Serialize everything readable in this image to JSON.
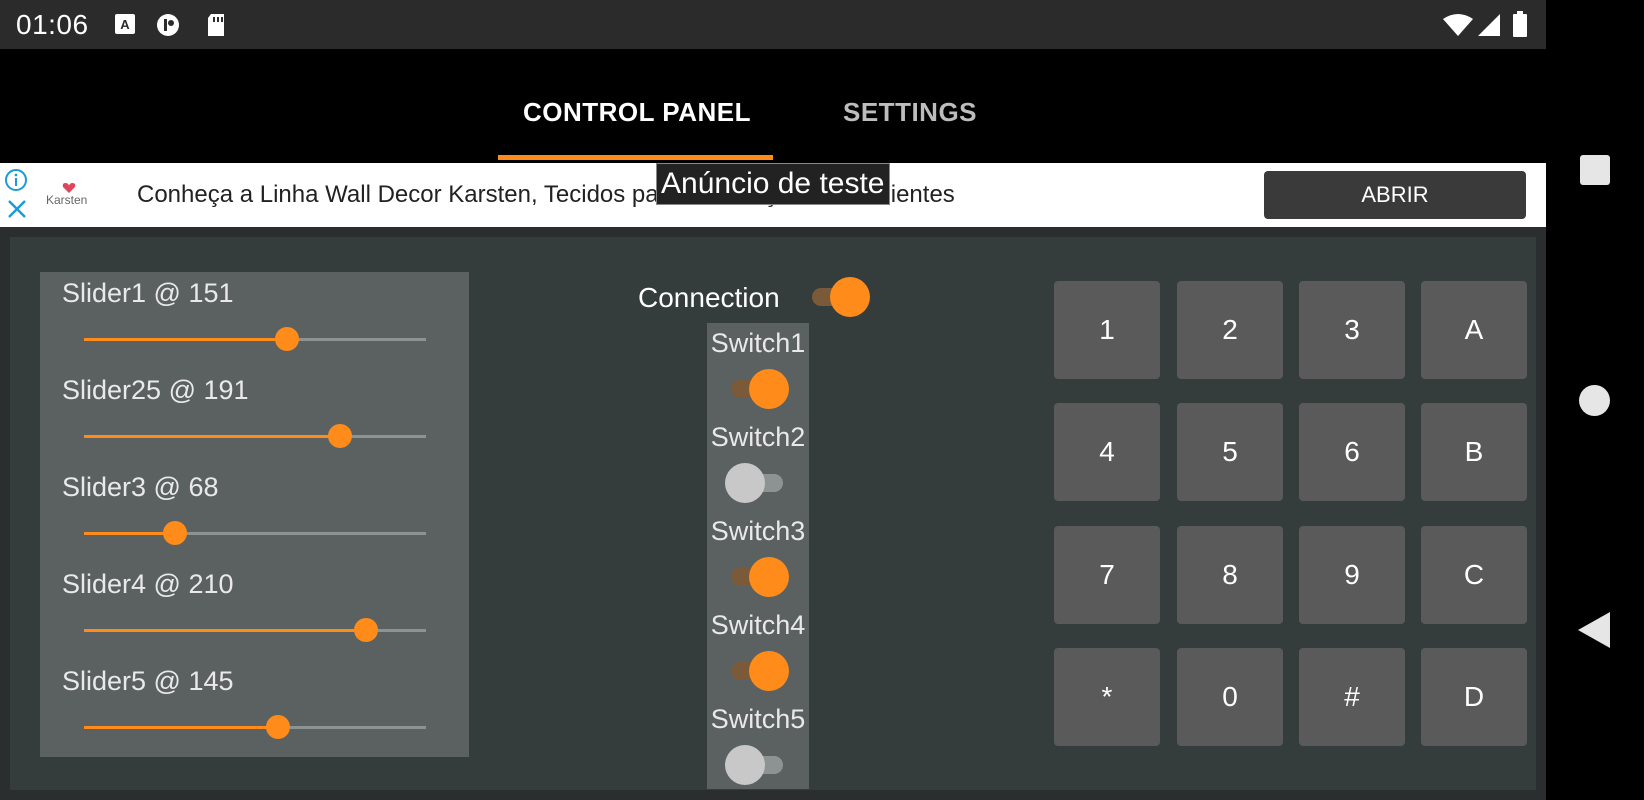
{
  "status_bar": {
    "time": "01:06",
    "left_icons": [
      "font-a-icon",
      "pocket-app-icon",
      "sd-card-icon"
    ],
    "right_icons": [
      "wifi-icon",
      "signal-icon",
      "battery-icon"
    ]
  },
  "tabs": [
    {
      "label": "CONTROL PANEL",
      "active": true
    },
    {
      "label": "SETTINGS",
      "active": false
    }
  ],
  "ad": {
    "brand": "Karsten",
    "text": "Conheça a Linha Wall Decor Karsten, Tecidos para Decoração de Ambientes",
    "button": "ABRIR",
    "test_label": "Anúncio de teste"
  },
  "sliders": [
    {
      "label": "Slider1 @ 151",
      "value": 151,
      "max": 255
    },
    {
      "label": "Slider25 @ 191",
      "value": 191,
      "max": 255
    },
    {
      "label": "Slider3 @ 68",
      "value": 68,
      "max": 255
    },
    {
      "label": "Slider4 @ 210",
      "value": 210,
      "max": 255
    },
    {
      "label": "Slider5 @ 145",
      "value": 145,
      "max": 255
    }
  ],
  "connection": {
    "label": "Connection",
    "on": true
  },
  "switches": [
    {
      "label": "Switch1",
      "on": true
    },
    {
      "label": "Switch2",
      "on": false
    },
    {
      "label": "Switch3",
      "on": true
    },
    {
      "label": "Switch4",
      "on": true
    },
    {
      "label": "Switch5",
      "on": false
    }
  ],
  "keypad": [
    [
      "1",
      "2",
      "3",
      "A"
    ],
    [
      "4",
      "5",
      "6",
      "B"
    ],
    [
      "7",
      "8",
      "9",
      "C"
    ],
    [
      "*",
      "0",
      "#",
      "D"
    ]
  ],
  "colors": {
    "accent": "#ff8c1a",
    "panel_bg": "#353c3c",
    "box_bg": "#5b6161",
    "key_bg": "#5a5a5a"
  }
}
